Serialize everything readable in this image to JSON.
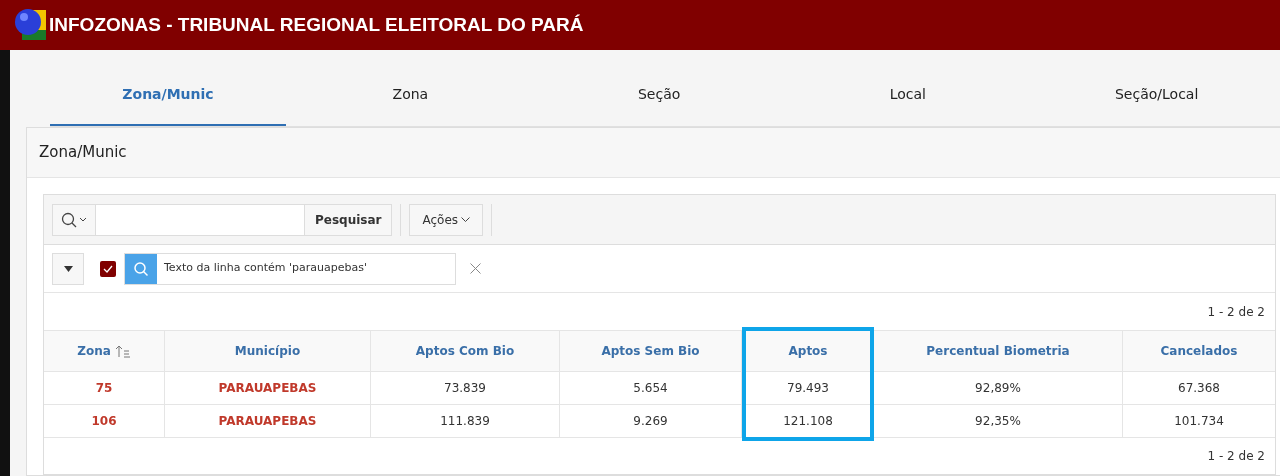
{
  "header": {
    "title": "INFOZONAS - TRIBUNAL REGIONAL ELEITORAL DO PARÁ"
  },
  "tabs": [
    {
      "label": "Zona/Munic",
      "selected": true
    },
    {
      "label": "Zona",
      "selected": false
    },
    {
      "label": "Seção",
      "selected": false
    },
    {
      "label": "Local",
      "selected": false
    },
    {
      "label": "Seção/Local",
      "selected": false
    }
  ],
  "panel": {
    "title": "Zona/Munic"
  },
  "toolbar": {
    "search_button": "Pesquisar",
    "actions_button": "Ações"
  },
  "filter": {
    "checked": true,
    "text": "Texto da linha contém 'parauapebas'"
  },
  "pagination_top": "1 - 2 de 2",
  "table": {
    "columns": [
      {
        "label": "Zona",
        "sorted": true,
        "highlighted": false
      },
      {
        "label": "Município",
        "sorted": false,
        "highlighted": false
      },
      {
        "label": "Aptos Com Bio",
        "sorted": false,
        "highlighted": false
      },
      {
        "label": "Aptos Sem Bio",
        "sorted": false,
        "highlighted": false
      },
      {
        "label": "Aptos",
        "sorted": false,
        "highlighted": true
      },
      {
        "label": "Percentual Biometria",
        "sorted": false,
        "highlighted": false
      },
      {
        "label": "Cancelados",
        "sorted": false,
        "highlighted": false
      }
    ],
    "rows": [
      [
        "75",
        "PARAUAPEBAS",
        "73.839",
        "5.654",
        "79.493",
        "92,89%",
        "67.368"
      ],
      [
        "106",
        "PARAUAPEBAS",
        "111.839",
        "9.269",
        "121.108",
        "92,35%",
        "101.734"
      ]
    ]
  },
  "pagination_bottom": "1 - 2 de 2"
}
